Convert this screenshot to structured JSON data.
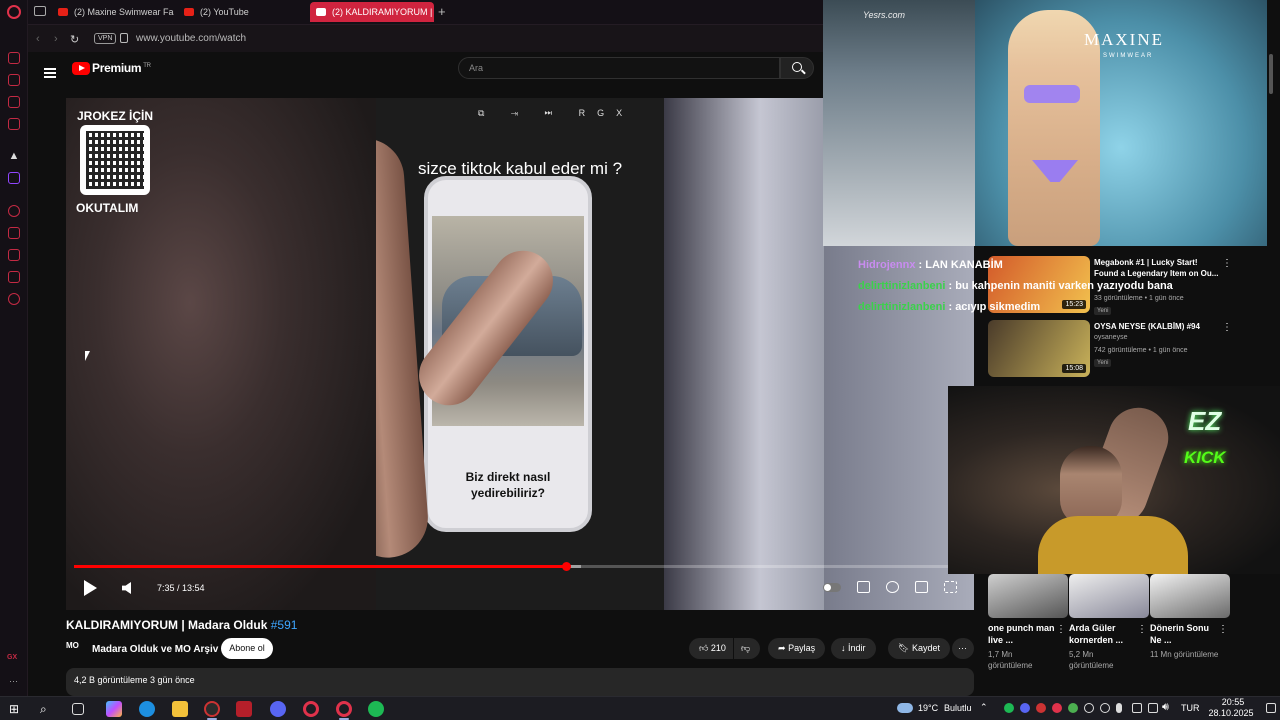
{
  "browser": {
    "tabs": [
      {
        "label": "(2) Maxine Swimwear Fas"
      },
      {
        "label": "(2) YouTube"
      },
      {
        "label": "(2) KALDIRAMIYORUM | N"
      }
    ],
    "vpn_label": "VPN",
    "url": "www.youtube.com/watch"
  },
  "youtube": {
    "brand": "Premium",
    "brand_region": "TR",
    "search_placeholder": "Ara"
  },
  "player": {
    "overlay_qr_title": "JROKEZ İÇİN",
    "overlay_qr_subtitle": "OKUTALIM",
    "caption": "sizce tiktok kabul eder mi ?",
    "phone_text": "Biz direkt nasıl yedirebiliriz?",
    "top_icon_label": "RGX",
    "time": "7:35 / 13:54",
    "progress_fraction": 0.552,
    "buffered_fraction": 0.568
  },
  "video": {
    "title": "KALDIRAMIYORUM | Madara Olduk",
    "title_tag": "#591",
    "channel_logo": "MO",
    "channel": "Madara Olduk ve MO Arşiv",
    "subscribe": "Abone ol",
    "likes": "210",
    "share": "Paylaş",
    "download": "İndir",
    "save": "Kaydet",
    "stats": "4,2 B görüntüleme  3 gün önce"
  },
  "stream_overlay": {
    "runway_watermark": "Yesrs.com",
    "ad_brand": "MAXINE",
    "ad_sub": "SWIMWEAR",
    "chat": [
      {
        "user": "Hidrojennx",
        "message": ": LAN KANABİM"
      },
      {
        "user": "delirttinizlanbeni",
        "message": ": bu kahpenin maniti varken yazıyodu bana"
      },
      {
        "user": "delirttinizlanbeni",
        "message": ": acıyıp sikmedim"
      }
    ],
    "webcam_logo1": "EZ",
    "webcam_logo2": "KICK"
  },
  "recommendations": [
    {
      "title": "Megabonk #1 | Lucky Start! Found a Legendary Item on Ou...",
      "channel": "",
      "meta": "33 görüntüleme • 1 gün önce",
      "badge": "Yeni",
      "duration": "15:23"
    },
    {
      "title": "OYSA NEYSE (KALBİM) #94",
      "channel": "oysaneyse",
      "meta": "742 görüntüleme • 1 gün önce",
      "badge": "Yeni",
      "duration": "15:08"
    }
  ],
  "shorts": [
    {
      "title": "one punch man live ...",
      "views": "1,7 Mn görüntüleme"
    },
    {
      "title": "Arda Güler kornerden ...",
      "views": "5,2 Mn görüntüleme"
    },
    {
      "title": "Dönerin Sonu Ne ...",
      "views": "11 Mn görüntüleme"
    }
  ],
  "taskbar": {
    "weather_temp": "19°C",
    "weather_desc": "Bulutlu",
    "lang": "TUR",
    "time": "20:55",
    "date": "28.10.2025"
  },
  "colors": {
    "accent": "#ff0000",
    "opera": "#e0324b",
    "kick": "#53fc18",
    "chat_user1": "#c98cf0",
    "chat_user2": "#3bd14b"
  }
}
